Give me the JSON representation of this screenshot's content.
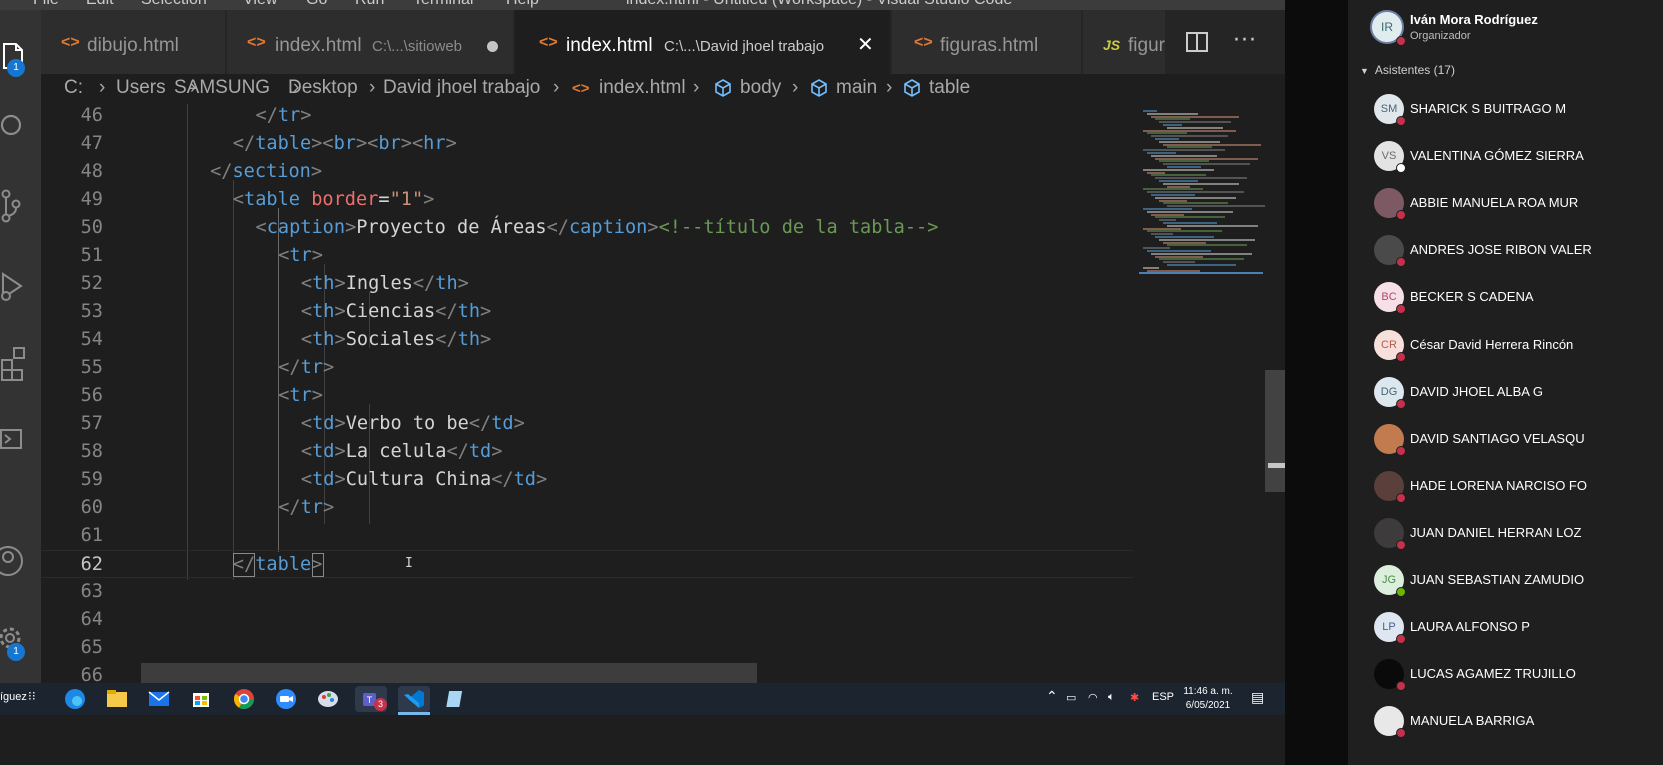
{
  "window": {
    "menu": [
      "File",
      "Edit",
      "Selection",
      "View",
      "Go",
      "Run",
      "Terminal",
      "Help"
    ],
    "title": "index.html - Untitled (Workspace) - Visual Studio Code"
  },
  "activity_bar": {
    "explorer_badge": "1",
    "settings_badge": "1"
  },
  "tabs": [
    {
      "label": "dibujo.html",
      "desc": "",
      "state": "normal"
    },
    {
      "label": "index.html",
      "desc": "C:\\...\\sitioweb",
      "state": "modified"
    },
    {
      "label": "index.html",
      "desc": "C:\\...\\David jhoel trabajo",
      "state": "active"
    },
    {
      "label": "figuras.html",
      "desc": "",
      "state": "normal"
    },
    {
      "label": "figura",
      "desc": "",
      "state": "js"
    }
  ],
  "breadcrumb": [
    "C:",
    "Users",
    "SAMSUNG",
    "Desktop",
    "David jhoel trabajo",
    "index.html",
    "body",
    "main",
    "table"
  ],
  "code_lines": [
    {
      "n": "46",
      "tokens": [
        [
          "tk-bracket",
          "</"
        ],
        [
          "tk-tag",
          "tr"
        ],
        [
          "tk-bracket",
          ">"
        ]
      ],
      "indent": 10
    },
    {
      "n": "47",
      "tokens": [
        [
          "tk-bracket",
          "</"
        ],
        [
          "tk-tag",
          "table"
        ],
        [
          "tk-bracket",
          ">"
        ],
        [
          "tk-bracket",
          "<"
        ],
        [
          "tk-tag",
          "br"
        ],
        [
          "tk-bracket",
          ">"
        ],
        [
          "tk-bracket",
          "<"
        ],
        [
          "tk-tag",
          "br"
        ],
        [
          "tk-bracket",
          ">"
        ],
        [
          "tk-bracket",
          "<"
        ],
        [
          "tk-tag",
          "hr"
        ],
        [
          "tk-bracket",
          ">"
        ]
      ],
      "indent": 8
    },
    {
      "n": "48",
      "tokens": [
        [
          "tk-bracket",
          "</"
        ],
        [
          "tk-tag",
          "section"
        ],
        [
          "tk-bracket",
          ">"
        ]
      ],
      "indent": 6
    },
    {
      "n": "49",
      "tokens": [
        [
          "tk-bracket",
          "<"
        ],
        [
          "tk-tag",
          "table"
        ],
        [
          "tk-text",
          " "
        ],
        [
          "tk-attr",
          "border"
        ],
        [
          "tk-text",
          "="
        ],
        [
          "tk-str",
          "\"1\""
        ],
        [
          "tk-bracket",
          ">"
        ]
      ],
      "indent": 8
    },
    {
      "n": "50",
      "tokens": [
        [
          "tk-bracket",
          "<"
        ],
        [
          "tk-tag",
          "caption"
        ],
        [
          "tk-bracket",
          ">"
        ],
        [
          "tk-text",
          "Proyecto de Áreas"
        ],
        [
          "tk-bracket",
          "</"
        ],
        [
          "tk-tag",
          "caption"
        ],
        [
          "tk-bracket",
          ">"
        ],
        [
          "tk-comment",
          "<!--título de la tabla-->"
        ]
      ],
      "indent": 10
    },
    {
      "n": "51",
      "tokens": [
        [
          "tk-bracket",
          "<"
        ],
        [
          "tk-tag",
          "tr"
        ],
        [
          "tk-bracket",
          ">"
        ]
      ],
      "indent": 12
    },
    {
      "n": "52",
      "tokens": [
        [
          "tk-bracket",
          "<"
        ],
        [
          "tk-tag",
          "th"
        ],
        [
          "tk-bracket",
          ">"
        ],
        [
          "tk-text",
          "Ingles"
        ],
        [
          "tk-bracket",
          "</"
        ],
        [
          "tk-tag",
          "th"
        ],
        [
          "tk-bracket",
          ">"
        ]
      ],
      "indent": 14
    },
    {
      "n": "53",
      "tokens": [
        [
          "tk-bracket",
          "<"
        ],
        [
          "tk-tag",
          "th"
        ],
        [
          "tk-bracket",
          ">"
        ],
        [
          "tk-text",
          "Ciencias"
        ],
        [
          "tk-bracket",
          "</"
        ],
        [
          "tk-tag",
          "th"
        ],
        [
          "tk-bracket",
          ">"
        ]
      ],
      "indent": 14
    },
    {
      "n": "54",
      "tokens": [
        [
          "tk-bracket",
          "<"
        ],
        [
          "tk-tag",
          "th"
        ],
        [
          "tk-bracket",
          ">"
        ],
        [
          "tk-text",
          "Sociales"
        ],
        [
          "tk-bracket",
          "</"
        ],
        [
          "tk-tag",
          "th"
        ],
        [
          "tk-bracket",
          ">"
        ]
      ],
      "indent": 14
    },
    {
      "n": "55",
      "tokens": [
        [
          "tk-bracket",
          "</"
        ],
        [
          "tk-tag",
          "tr"
        ],
        [
          "tk-bracket",
          ">"
        ]
      ],
      "indent": 12
    },
    {
      "n": "56",
      "tokens": [
        [
          "tk-bracket",
          "<"
        ],
        [
          "tk-tag",
          "tr"
        ],
        [
          "tk-bracket",
          ">"
        ]
      ],
      "indent": 12
    },
    {
      "n": "57",
      "tokens": [
        [
          "tk-bracket",
          "<"
        ],
        [
          "tk-tag",
          "td"
        ],
        [
          "tk-bracket",
          ">"
        ],
        [
          "tk-text",
          "Verbo to be"
        ],
        [
          "tk-bracket",
          "</"
        ],
        [
          "tk-tag",
          "td"
        ],
        [
          "tk-bracket",
          ">"
        ]
      ],
      "indent": 14
    },
    {
      "n": "58",
      "tokens": [
        [
          "tk-bracket",
          "<"
        ],
        [
          "tk-tag",
          "td"
        ],
        [
          "tk-bracket",
          ">"
        ],
        [
          "tk-text",
          "La celula"
        ],
        [
          "tk-bracket",
          "</"
        ],
        [
          "tk-tag",
          "td"
        ],
        [
          "tk-bracket",
          ">"
        ]
      ],
      "indent": 14
    },
    {
      "n": "59",
      "tokens": [
        [
          "tk-bracket",
          "<"
        ],
        [
          "tk-tag",
          "td"
        ],
        [
          "tk-bracket",
          ">"
        ],
        [
          "tk-text",
          "Cultura China"
        ],
        [
          "tk-bracket",
          "</"
        ],
        [
          "tk-tag",
          "td"
        ],
        [
          "tk-bracket",
          ">"
        ]
      ],
      "indent": 14
    },
    {
      "n": "60",
      "tokens": [
        [
          "tk-bracket",
          "</"
        ],
        [
          "tk-tag",
          "tr"
        ],
        [
          "tk-bracket",
          ">"
        ]
      ],
      "indent": 12
    },
    {
      "n": "61",
      "tokens": [],
      "indent": 0
    },
    {
      "n": "62",
      "tokens": [
        [
          "tk-bracket",
          "</"
        ],
        [
          "tk-tag",
          "table"
        ],
        [
          "tk-bracket",
          ">"
        ]
      ],
      "indent": 8,
      "current": true
    },
    {
      "n": "63",
      "tokens": [],
      "indent": 0
    },
    {
      "n": "64",
      "tokens": [],
      "indent": 0
    },
    {
      "n": "65",
      "tokens": [],
      "indent": 0
    },
    {
      "n": "66",
      "tokens": [],
      "indent": 0
    }
  ],
  "taskbar": {
    "left_text": "íguez",
    "language": "ESP",
    "time": "11:46 a. m.",
    "date": "6/05/2021",
    "teams_badge": "3"
  },
  "teams": {
    "organizer": {
      "initials": "IR",
      "name": "Iván Mora Rodríguez",
      "role": "Organizador"
    },
    "attendees_header": "Asistentes (17)",
    "attendees": [
      {
        "initials": "SM",
        "name": "SHARICK S BUITRAGO M",
        "avatar_bg": "#dfe7ec",
        "avatar_fg": "#4b6573",
        "status": "#c4314b"
      },
      {
        "initials": "VS",
        "name": "VALENTINA GÓMEZ SIERRA",
        "avatar_bg": "#e3e3e3",
        "avatar_fg": "#6b6b6b",
        "status": "#ffffff"
      },
      {
        "initials": "",
        "name": "ABBIE MANUELA ROA MUR",
        "avatar_bg": "#7d5a63",
        "avatar_fg": "#ffffff",
        "status": "#c4314b"
      },
      {
        "initials": "",
        "name": "ANDRES JOSE RIBON VALER",
        "avatar_bg": "#4a4a4a",
        "avatar_fg": "#ffffff",
        "status": "#c4314b"
      },
      {
        "initials": "BC",
        "name": "BECKER S CADENA",
        "avatar_bg": "#f6dfe6",
        "avatar_fg": "#b04a6c",
        "status": "#c4314b"
      },
      {
        "initials": "CR",
        "name": "César David Herrera Rincón",
        "avatar_bg": "#f7e0dc",
        "avatar_fg": "#b35a4a",
        "status": "#c4314b"
      },
      {
        "initials": "DG",
        "name": "DAVID JHOEL ALBA G",
        "avatar_bg": "#dde7ee",
        "avatar_fg": "#456577",
        "status": "#c4314b"
      },
      {
        "initials": "",
        "name": "DAVID SANTIAGO VELASQU",
        "avatar_bg": "#c27a4f",
        "avatar_fg": "#ffffff",
        "status": "#c4314b"
      },
      {
        "initials": "",
        "name": "HADE LORENA NARCISO FO",
        "avatar_bg": "#5a3f3a",
        "avatar_fg": "#ffffff",
        "status": "#c4314b"
      },
      {
        "initials": "",
        "name": "JUAN DANIEL HERRAN LOZ",
        "avatar_bg": "#3d3b3b",
        "avatar_fg": "#ffffff",
        "status": "#c4314b"
      },
      {
        "initials": "JG",
        "name": "JUAN SEBASTIAN ZAMUDIO",
        "avatar_bg": "#dcefdc",
        "avatar_fg": "#4c8a4c",
        "status": "#6bb700"
      },
      {
        "initials": "LP",
        "name": "LAURA ALFONSO P",
        "avatar_bg": "#dde6f1",
        "avatar_fg": "#4a6385",
        "status": "#c4314b"
      },
      {
        "initials": "",
        "name": "LUCAS AGAMEZ TRUJILLO",
        "avatar_bg": "#0a0a0a",
        "avatar_fg": "#ffffff",
        "status": "#c4314b"
      },
      {
        "initials": "",
        "name": "MANUELA BARRIGA",
        "avatar_bg": "#e8e8e8",
        "avatar_fg": "#555555",
        "status": "#c4314b"
      }
    ]
  },
  "colors": {
    "editor_bg": "#1e1e1e",
    "tag": "#569cd6",
    "attr": "#f06d6d",
    "string": "#ce9178",
    "comment": "#6a9955",
    "accent": "#1677d3"
  }
}
